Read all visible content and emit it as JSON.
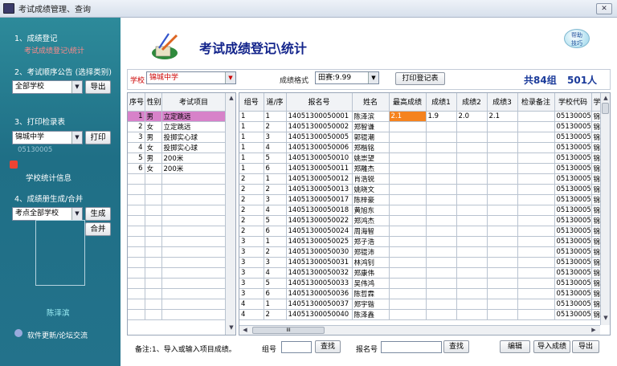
{
  "window": {
    "title": "考试成绩管理、查询"
  },
  "sidebar": {
    "section1": {
      "title": "1、成绩登记",
      "link": "考试成绩登记\\统计"
    },
    "section2": {
      "title": "2、考试顺序公告 (选择类别)",
      "select": "全部学校",
      "button": "导出"
    },
    "section3": {
      "title": "3、打印检录表",
      "select": "锦城中学",
      "button": "打印",
      "code": "05130005",
      "stats_link": "学校统计信息"
    },
    "section4": {
      "title": "4、成绩册生成/合并",
      "select": "考点全部学校",
      "btn_generate": "生成",
      "btn_merge": "合并"
    },
    "person_name": "陈泽滨",
    "update_link": "软件更新/论坛交流"
  },
  "header": {
    "title": "考试成绩登记\\统计",
    "help": [
      "帮助",
      "技巧"
    ]
  },
  "filter": {
    "school_label": "学校",
    "school_value": "锦城中学",
    "format_label": "成绩格式",
    "format_value": "田赛:9.99",
    "print_button": "打印登记表",
    "groups": "共84组",
    "persons": "501人"
  },
  "events": {
    "columns": [
      "序号",
      "性别",
      "考试项目"
    ],
    "rows": [
      [
        "1",
        "男",
        "立定跳远"
      ],
      [
        "2",
        "女",
        "立定跳远"
      ],
      [
        "3",
        "男",
        "投掷实心球"
      ],
      [
        "4",
        "女",
        "投掷实心球"
      ],
      [
        "5",
        "男",
        "200米"
      ],
      [
        "6",
        "女",
        "200米"
      ]
    ]
  },
  "results": {
    "columns": [
      "组号",
      "道/序",
      "报名号",
      "姓名",
      "最高成绩",
      "成绩1",
      "成绩2",
      "成绩3",
      "检录备注",
      "学校代码",
      "学"
    ],
    "rows": [
      [
        "1",
        "1",
        "14051300050001",
        "陈泽滨",
        "2.1",
        "1.9",
        "2.0",
        "2.1",
        "",
        "05130005",
        "锦"
      ],
      [
        "1",
        "2",
        "14051300050002",
        "郑智谦",
        "",
        "",
        "",
        "",
        "",
        "05130005",
        "锦"
      ],
      [
        "1",
        "3",
        "14051300050005",
        "郭锟潮",
        "",
        "",
        "",
        "",
        "",
        "05130005",
        "锦"
      ],
      [
        "1",
        "4",
        "14051300050006",
        "郑楷铭",
        "",
        "",
        "",
        "",
        "",
        "05130005",
        "锦"
      ],
      [
        "1",
        "5",
        "14051300050010",
        "姚崇望",
        "",
        "",
        "",
        "",
        "",
        "05130005",
        "锦"
      ],
      [
        "1",
        "6",
        "14051300050011",
        "郑雕杰",
        "",
        "",
        "",
        "",
        "",
        "05130005",
        "锦"
      ],
      [
        "2",
        "1",
        "14051300050012",
        "肖浩锐",
        "",
        "",
        "",
        "",
        "",
        "05130005",
        "锦"
      ],
      [
        "2",
        "2",
        "14051300050013",
        "姚晓文",
        "",
        "",
        "",
        "",
        "",
        "05130005",
        "锦"
      ],
      [
        "2",
        "3",
        "14051300050017",
        "陈梓豪",
        "",
        "",
        "",
        "",
        "",
        "05130005",
        "锦"
      ],
      [
        "2",
        "4",
        "14051300050018",
        "黄旭东",
        "",
        "",
        "",
        "",
        "",
        "05130005",
        "锦"
      ],
      [
        "2",
        "5",
        "14051300050022",
        "郑鸿杰",
        "",
        "",
        "",
        "",
        "",
        "05130005",
        "锦"
      ],
      [
        "2",
        "6",
        "14051300050024",
        "周海智",
        "",
        "",
        "",
        "",
        "",
        "05130005",
        "锦"
      ],
      [
        "3",
        "1",
        "14051300050025",
        "郑子浩",
        "",
        "",
        "",
        "",
        "",
        "05130005",
        "锦"
      ],
      [
        "3",
        "2",
        "14051300050030",
        "郑锟沛",
        "",
        "",
        "",
        "",
        "",
        "05130005",
        "锦"
      ],
      [
        "3",
        "3",
        "14051300050031",
        "林鸿钊",
        "",
        "",
        "",
        "",
        "",
        "05130005",
        "锦"
      ],
      [
        "3",
        "4",
        "14051300050032",
        "郑康伟",
        "",
        "",
        "",
        "",
        "",
        "05130005",
        "锦"
      ],
      [
        "3",
        "5",
        "14051300050033",
        "吴伟鸿",
        "",
        "",
        "",
        "",
        "",
        "05130005",
        "锦"
      ],
      [
        "3",
        "6",
        "14051300050036",
        "陈哲霖",
        "",
        "",
        "",
        "",
        "",
        "05130005",
        "锦"
      ],
      [
        "4",
        "1",
        "14051300050037",
        "郑宇锴",
        "",
        "",
        "",
        "",
        "",
        "05130005",
        "锦"
      ],
      [
        "4",
        "2",
        "14051300050040",
        "陈泽鑫",
        "",
        "",
        "",
        "",
        "",
        "05130005",
        "锦"
      ]
    ]
  },
  "footer": {
    "note": "备注:1、导入或输入项目成绩。",
    "group_label": "组号",
    "search": "查找",
    "regno_label": "报名号",
    "search2": "查找",
    "edit": "编辑",
    "import": "导入成绩",
    "export": "导出"
  },
  "scroll": {
    "hscroll_label": "III"
  },
  "colors": {
    "sidebar": "#23728b",
    "accent_title": "#13248b",
    "selected_event": "#d782c9",
    "active_cell": "#f5831f"
  }
}
